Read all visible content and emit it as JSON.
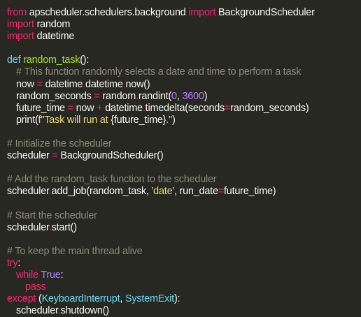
{
  "code": {
    "language": "python",
    "colors": {
      "background": "#272822",
      "text": "#f8f8f2",
      "keyword": "#f92672",
      "function": "#a6e22e",
      "comment": "#8c8a7a",
      "string": "#e6db74",
      "number": "#ae81ff",
      "builtin": "#66d9ef"
    },
    "lines": [
      {
        "indent": 0,
        "tokens": [
          {
            "t": "kw",
            "v": "from"
          },
          {
            "t": "tx",
            "v": " apscheduler.schedulers.background "
          },
          {
            "t": "kw",
            "v": "import"
          },
          {
            "t": "tx",
            "v": " BackgroundScheduler"
          }
        ]
      },
      {
        "indent": 0,
        "tokens": [
          {
            "t": "kw",
            "v": "import"
          },
          {
            "t": "tx",
            "v": " random"
          }
        ]
      },
      {
        "indent": 0,
        "tokens": [
          {
            "t": "kw",
            "v": "import"
          },
          {
            "t": "tx",
            "v": " datetime"
          }
        ]
      },
      {
        "indent": 0,
        "tokens": []
      },
      {
        "indent": 0,
        "tokens": [
          {
            "t": "bi",
            "v": "def"
          },
          {
            "t": "tx",
            "v": " "
          },
          {
            "t": "fn",
            "v": "random_task"
          },
          {
            "t": "tx",
            "v": "():"
          }
        ]
      },
      {
        "indent": 1,
        "tokens": [
          {
            "t": "cm",
            "v": "# This function randomly selects a date and time to perform a task"
          }
        ]
      },
      {
        "indent": 1,
        "tokens": [
          {
            "t": "tx",
            "v": "now "
          },
          {
            "t": "op",
            "v": "="
          },
          {
            "t": "tx",
            "v": " datetime"
          },
          {
            "t": "op",
            "v": "."
          },
          {
            "t": "tx",
            "v": "datetime"
          },
          {
            "t": "op",
            "v": "."
          },
          {
            "t": "tx",
            "v": "now()"
          }
        ]
      },
      {
        "indent": 1,
        "tokens": [
          {
            "t": "tx",
            "v": "random_seconds "
          },
          {
            "t": "op",
            "v": "="
          },
          {
            "t": "tx",
            "v": " random"
          },
          {
            "t": "op",
            "v": "."
          },
          {
            "t": "tx",
            "v": "randint("
          },
          {
            "t": "nu",
            "v": "0"
          },
          {
            "t": "tx",
            "v": ", "
          },
          {
            "t": "nu",
            "v": "3600"
          },
          {
            "t": "tx",
            "v": ")"
          }
        ]
      },
      {
        "indent": 1,
        "tokens": [
          {
            "t": "tx",
            "v": "future_time "
          },
          {
            "t": "op",
            "v": "="
          },
          {
            "t": "tx",
            "v": " now "
          },
          {
            "t": "op",
            "v": "+"
          },
          {
            "t": "tx",
            "v": " datetime"
          },
          {
            "t": "op",
            "v": "."
          },
          {
            "t": "tx",
            "v": "timedelta(seconds"
          },
          {
            "t": "op",
            "v": "="
          },
          {
            "t": "tx",
            "v": "random_seconds)"
          }
        ]
      },
      {
        "indent": 1,
        "tokens": [
          {
            "t": "tx",
            "v": "print("
          },
          {
            "t": "st",
            "v": "f\"Task will run at "
          },
          {
            "t": "tx",
            "v": "{future_time}"
          },
          {
            "t": "st",
            "v": ".\""
          },
          {
            "t": "tx",
            "v": ")"
          }
        ]
      },
      {
        "indent": 0,
        "tokens": []
      },
      {
        "indent": 0,
        "tokens": [
          {
            "t": "cm",
            "v": "# Initialize the scheduler"
          }
        ]
      },
      {
        "indent": 0,
        "tokens": [
          {
            "t": "tx",
            "v": "scheduler "
          },
          {
            "t": "op",
            "v": "="
          },
          {
            "t": "tx",
            "v": " BackgroundScheduler()"
          }
        ]
      },
      {
        "indent": 0,
        "tokens": []
      },
      {
        "indent": 0,
        "tokens": [
          {
            "t": "cm",
            "v": "# Add the random_task function to the scheduler"
          }
        ]
      },
      {
        "indent": 0,
        "tokens": [
          {
            "t": "tx",
            "v": "scheduler"
          },
          {
            "t": "op",
            "v": "."
          },
          {
            "t": "tx",
            "v": "add_job(random_task, "
          },
          {
            "t": "st",
            "v": "'date'"
          },
          {
            "t": "tx",
            "v": ", run_date"
          },
          {
            "t": "op",
            "v": "="
          },
          {
            "t": "tx",
            "v": "future_time)"
          }
        ]
      },
      {
        "indent": 0,
        "tokens": []
      },
      {
        "indent": 0,
        "tokens": [
          {
            "t": "cm",
            "v": "# Start the scheduler"
          }
        ]
      },
      {
        "indent": 0,
        "tokens": [
          {
            "t": "tx",
            "v": "scheduler"
          },
          {
            "t": "op",
            "v": "."
          },
          {
            "t": "tx",
            "v": "start()"
          }
        ]
      },
      {
        "indent": 0,
        "tokens": []
      },
      {
        "indent": 0,
        "tokens": [
          {
            "t": "cm",
            "v": "# To keep the main thread alive"
          }
        ]
      },
      {
        "indent": 0,
        "tokens": [
          {
            "t": "kw",
            "v": "try"
          },
          {
            "t": "tx",
            "v": ":"
          }
        ]
      },
      {
        "indent": 1,
        "tokens": [
          {
            "t": "kw",
            "v": "while"
          },
          {
            "t": "tx",
            "v": " "
          },
          {
            "t": "nu",
            "v": "True"
          },
          {
            "t": "tx",
            "v": ":"
          }
        ]
      },
      {
        "indent": 2,
        "tokens": [
          {
            "t": "kw",
            "v": "pass"
          }
        ]
      },
      {
        "indent": 0,
        "tokens": [
          {
            "t": "kw",
            "v": "except"
          },
          {
            "t": "tx",
            "v": " ("
          },
          {
            "t": "bi",
            "v": "KeyboardInterrupt"
          },
          {
            "t": "tx",
            "v": ", "
          },
          {
            "t": "bi",
            "v": "SystemExit"
          },
          {
            "t": "tx",
            "v": "):"
          }
        ]
      },
      {
        "indent": 1,
        "tokens": [
          {
            "t": "tx",
            "v": "scheduler"
          },
          {
            "t": "op",
            "v": "."
          },
          {
            "t": "tx",
            "v": "shutdown()"
          }
        ]
      }
    ]
  }
}
